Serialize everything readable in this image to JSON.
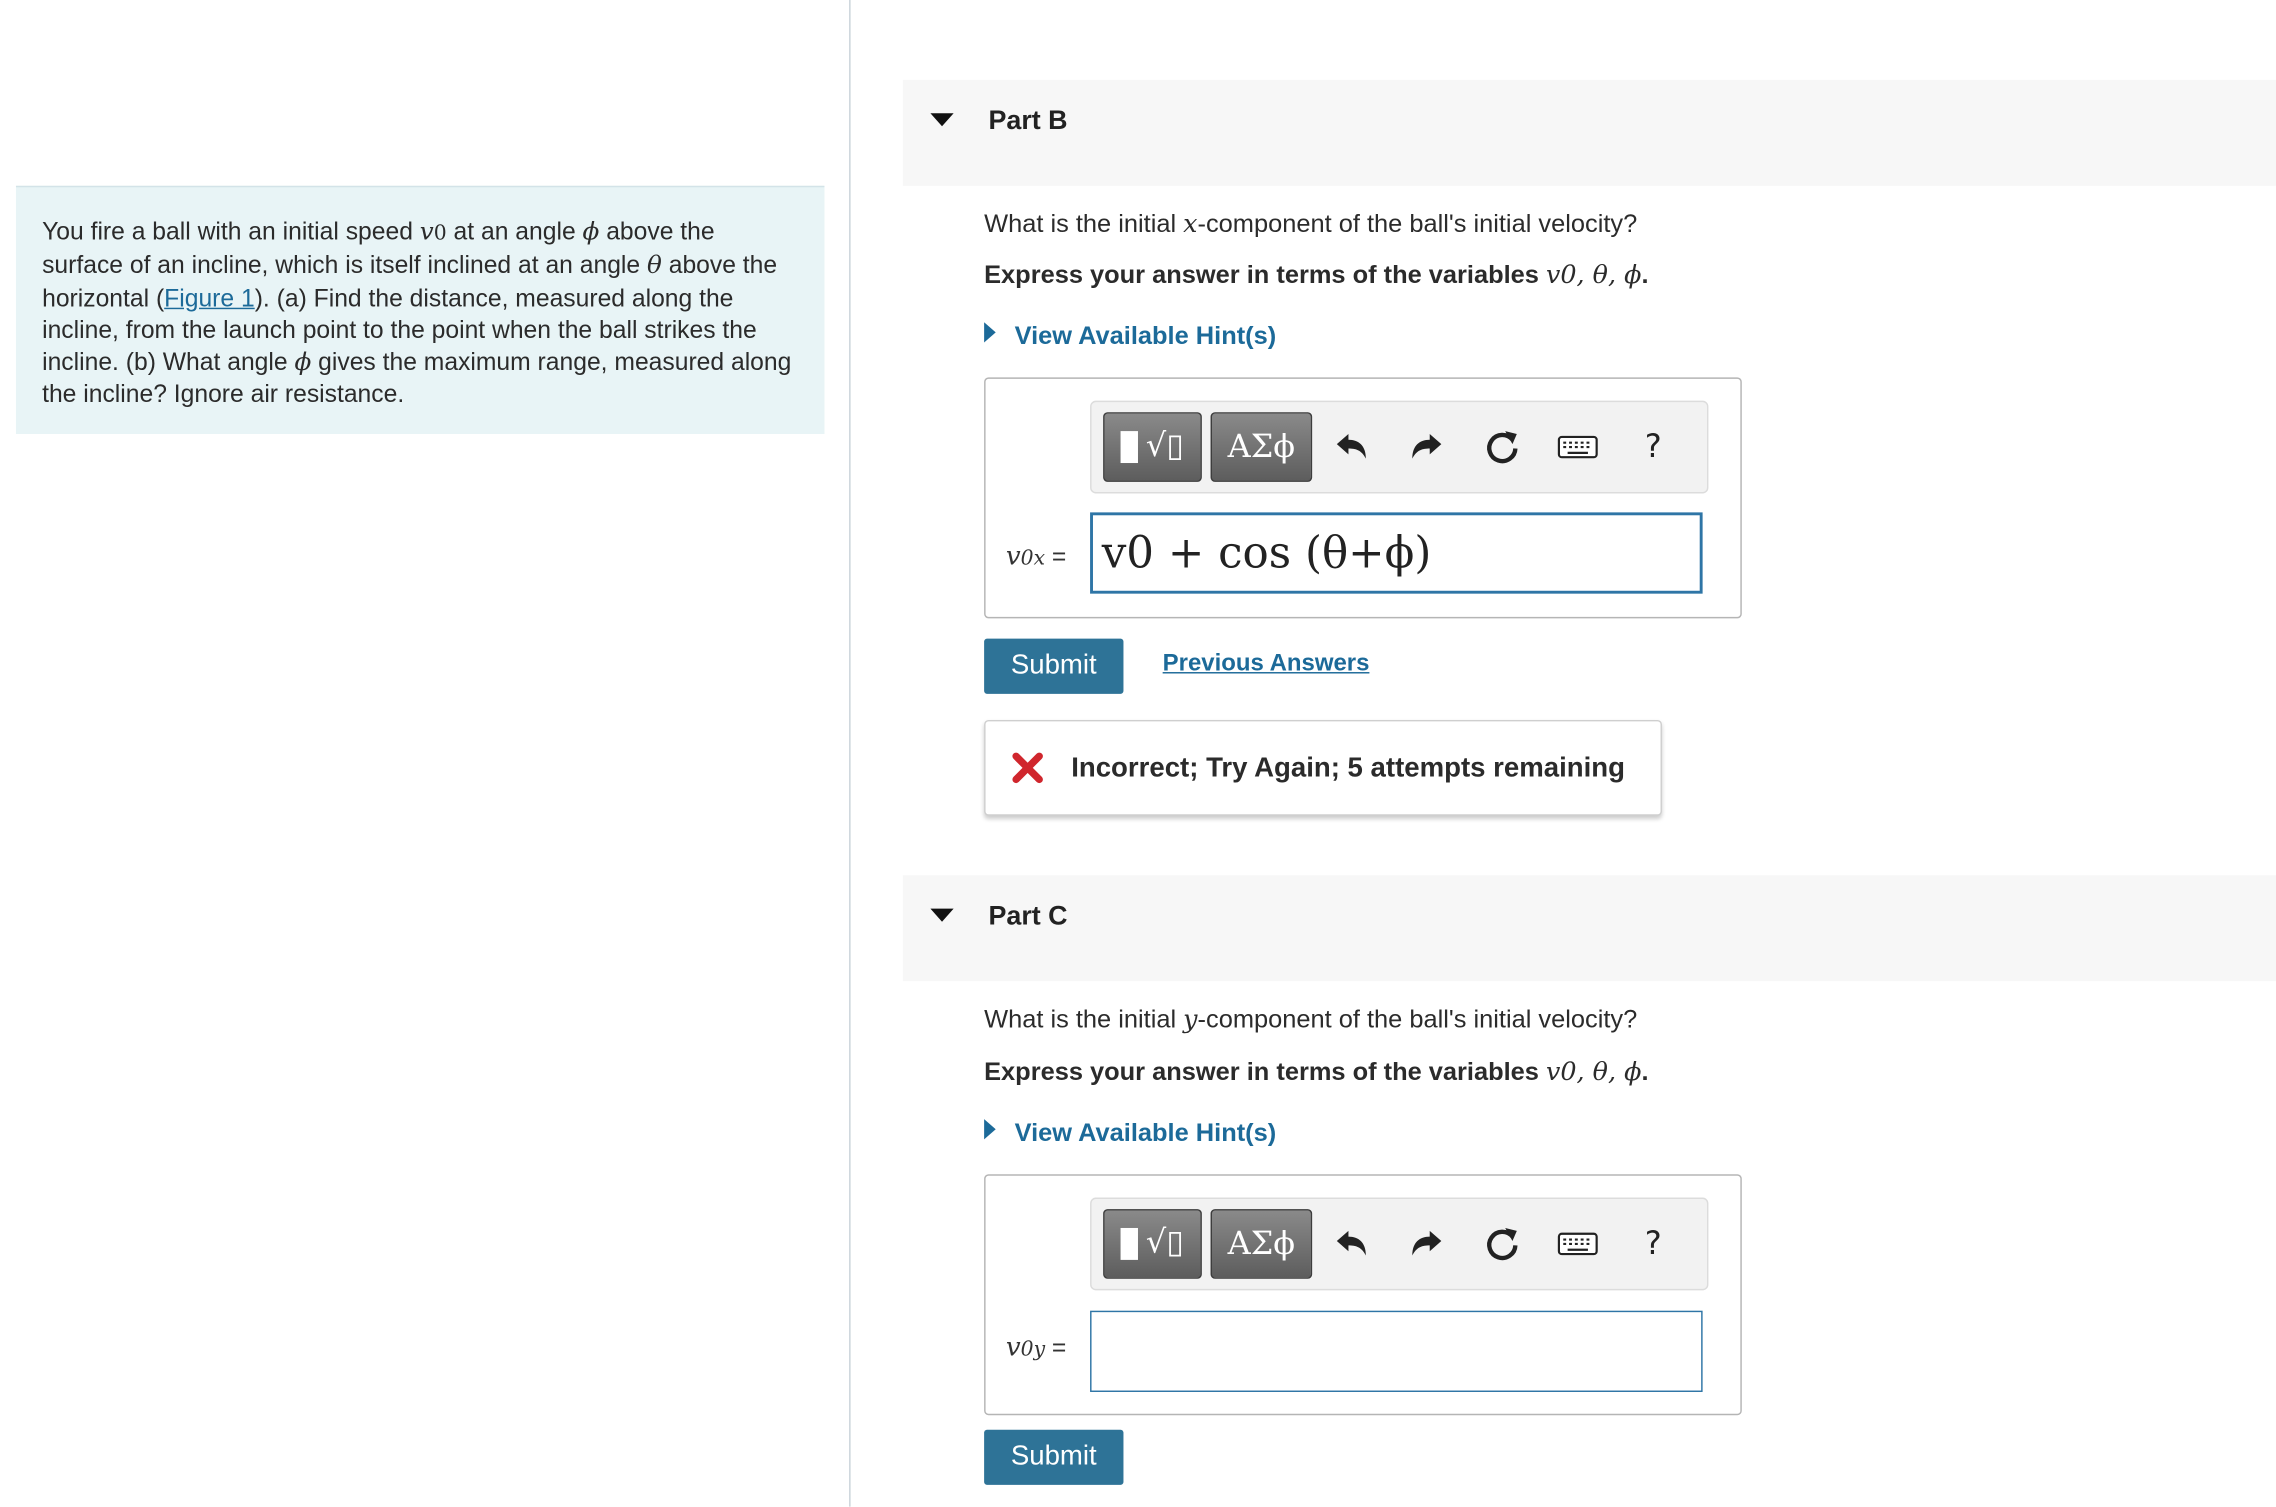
{
  "problem": {
    "t1": "You fire a ball with an initial speed ",
    "v0": "v",
    "v0_sub": "0",
    "t2": " at an angle ",
    "phi": "ϕ",
    "t3": " above the surface of an incline, which is itself inclined at an angle ",
    "theta": "θ",
    "t4": " above the horizontal (",
    "figure_link": "Figure 1",
    "t5": "). (a) Find the distance, measured along the incline, from the launch point to the point when the ball strikes the incline. (b) What angle ",
    "t6": " gives the maximum range, measured along the incline? Ignore air resistance."
  },
  "part_b": {
    "title": "Part B",
    "question_pre": "What is the initial ",
    "question_var": "x",
    "question_post": "-component of the ball's initial velocity?",
    "instruction": "Express your answer in terms of the variables ",
    "instruction_vars": "v0, θ, ϕ",
    "instruction_end": ".",
    "hint": "View Available Hint(s)",
    "label_var": "v",
    "label_sub": "0x",
    "label_eq": " =",
    "answer_value": "v0 + cos (θ+ϕ)",
    "submit": "Submit",
    "previous_answers": "Previous Answers",
    "feedback": "Incorrect; Try Again; 5 attempts remaining"
  },
  "part_c": {
    "title": "Part C",
    "question_pre": "What is the initial ",
    "question_var": "y",
    "question_post": "-component of the ball's initial velocity?",
    "instruction": "Express your answer in terms of the variables ",
    "instruction_vars": "v0, θ, ϕ",
    "instruction_end": ".",
    "hint": "View Available Hint(s)",
    "label_var": "v",
    "label_sub": "0y",
    "label_eq": " =",
    "answer_value": "",
    "submit": "Submit"
  },
  "toolbar": {
    "templates_glyph": "√▯",
    "greek_label": "ΑΣϕ",
    "help_label": "?",
    "icons": [
      "templates-icon",
      "greek-symbols-icon",
      "undo-icon",
      "redo-icon",
      "reset-icon",
      "keyboard-icon",
      "help-icon"
    ]
  },
  "colors": {
    "link": "#1c6a99",
    "submit_bg": "#2e7397",
    "input_border": "#2e75a6",
    "intro_bg": "#e8f4f6",
    "error": "#d0262d"
  }
}
